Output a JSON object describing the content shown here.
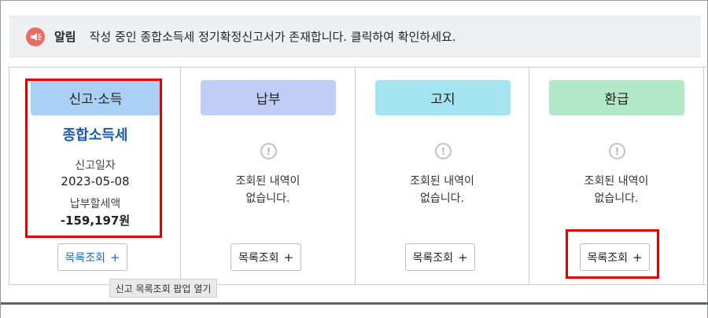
{
  "alert": {
    "title": "알림",
    "message": "작성 중인 종합소득세 정기확정신고서가 존재합니다. 클릭하여 확인하세요."
  },
  "columns": [
    {
      "header": "신고·소득",
      "header_color": "#abd0f5",
      "tax_type": "종합소득세",
      "filing_date_label": "신고일자",
      "filing_date": "2023-05-08",
      "tax_due_label": "납부할세액",
      "tax_due": "-159,197원",
      "button_label": "목록조회",
      "button_plus": "+"
    },
    {
      "header": "납부",
      "header_color": "#bfcdf7",
      "empty_line1": "조회된 내역이",
      "empty_line2": "없습니다.",
      "button_label": "목록조회",
      "button_plus": "+"
    },
    {
      "header": "고지",
      "header_color": "#a4e3f0",
      "empty_line1": "조회된 내역이",
      "empty_line2": "없습니다.",
      "button_label": "목록조회",
      "button_plus": "+"
    },
    {
      "header": "환급",
      "header_color": "#b0e8c8",
      "empty_line1": "조회된 내역이",
      "empty_line2": "없습니다.",
      "button_label": "목록조회",
      "button_plus": "+"
    }
  ],
  "tooltip": "신고 목록조회 팝업 열기",
  "icons": {
    "alert": "megaphone-icon",
    "empty": "exclamation-icon",
    "add": "plus-icon"
  },
  "colors": {
    "alert_icon_bg": "#ec6b62",
    "highlight_box": "#e00000",
    "tax_type_link": "#1f5aa6",
    "active_button_text": "#2566c4"
  }
}
